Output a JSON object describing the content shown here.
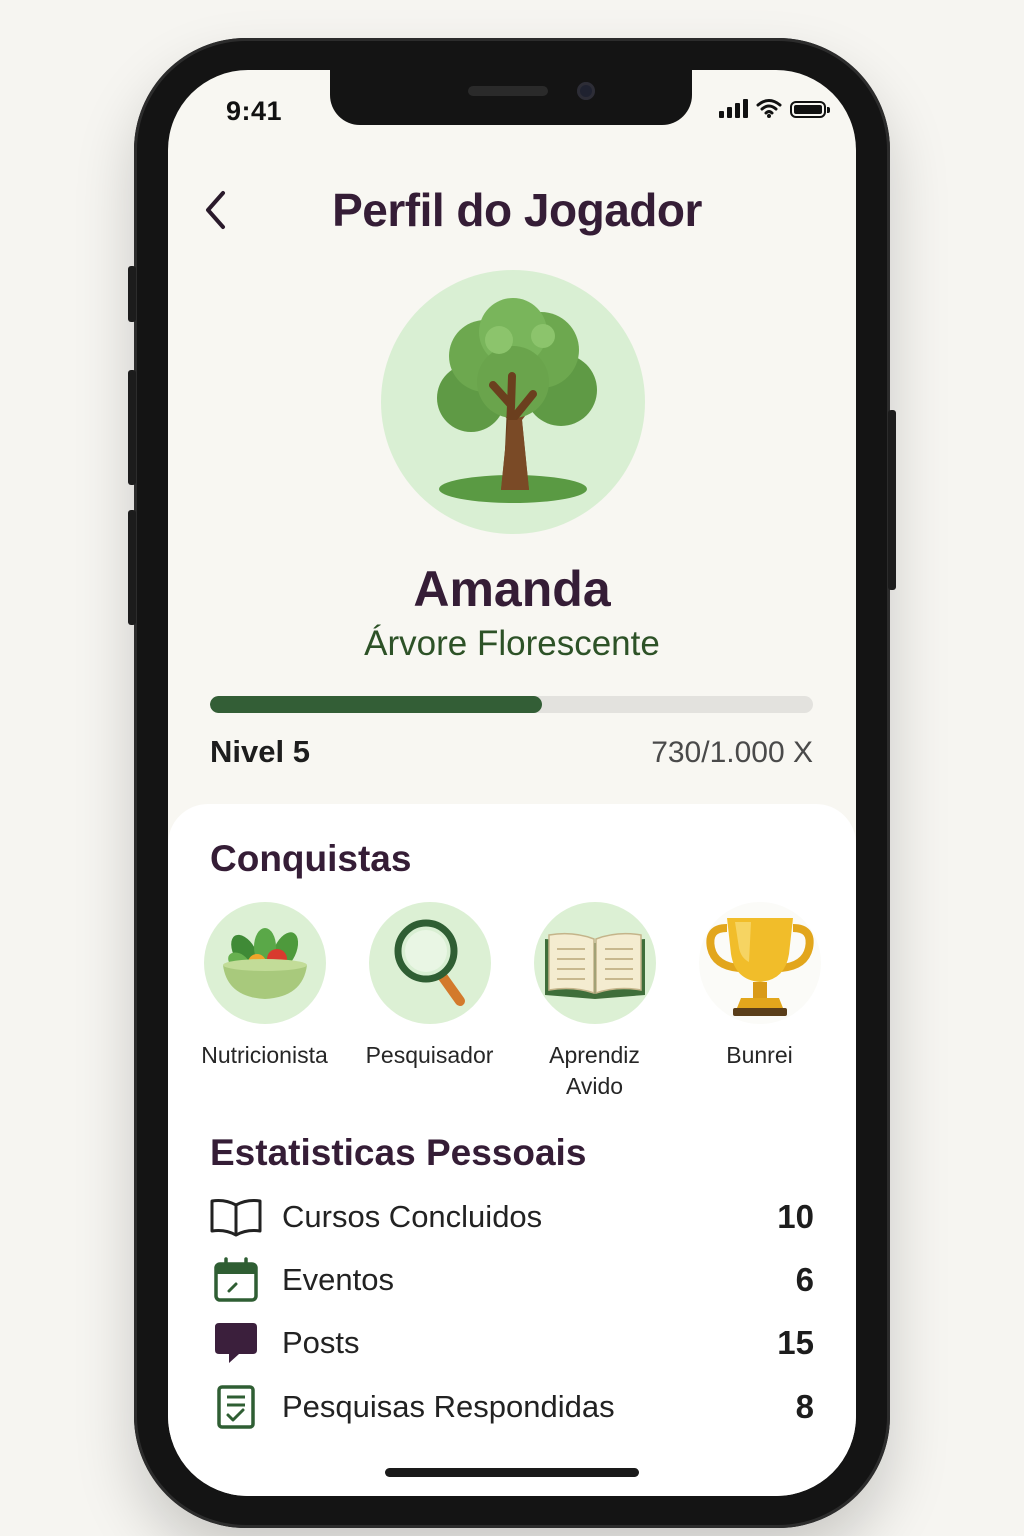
{
  "status_bar": {
    "time": "9:41"
  },
  "header": {
    "title": "Perfil do Jogador",
    "back_icon": "chevron-left-icon"
  },
  "profile": {
    "avatar_icon": "tree-icon",
    "name": "Amanda",
    "rank": "Árvore Florescente",
    "level": "Nivel 5",
    "xp_text": "730/1.000 X",
    "xp_progress": 0.55
  },
  "achievements": {
    "title": "Conquistas",
    "items": [
      {
        "label": "Nutricionista",
        "icon": "salad-bowl-icon"
      },
      {
        "label": "Pesquisador",
        "icon": "magnifier-icon"
      },
      {
        "label": "Aprendiz\nAvido",
        "icon": "open-book-icon"
      },
      {
        "label": "Bunrei",
        "icon": "trophy-icon"
      }
    ]
  },
  "stats": {
    "title": "Estatisticas Pessoais",
    "items": [
      {
        "label": "Cursos Concluidos",
        "value": "10",
        "icon": "book-icon"
      },
      {
        "label": "Eventos",
        "value": "6",
        "icon": "calendar-icon"
      },
      {
        "label": "Posts",
        "value": "15",
        "icon": "chat-bubble-icon"
      },
      {
        "label": "Pesquisas Respondidas",
        "value": "8",
        "icon": "survey-checklist-icon"
      }
    ]
  },
  "colors": {
    "title": "#351d36",
    "accent_green": "#335e36",
    "avatar_bg": "#d9efd3",
    "background": "#f8f7f2"
  }
}
